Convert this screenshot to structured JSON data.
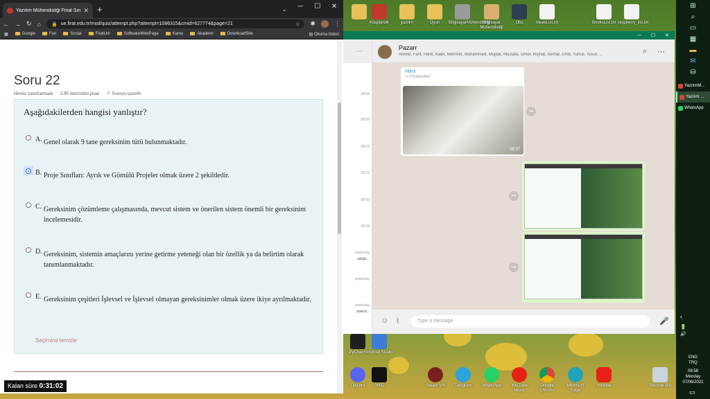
{
  "browser": {
    "tab_title": "Yazılım Mühendisliği Final Sınav...",
    "url": "ue.firat.edu.tr/mod/quiz/attempt.php?attempt=1086315&cmid=627774&page=21",
    "bookmarks": [
      "Google",
      "Fun",
      "Social",
      "FiratUni",
      "SoftwareWebPage",
      "Kamu",
      "Akademi",
      "DownloadSite"
    ],
    "reading_list": "Okuma listesi"
  },
  "quiz": {
    "title": "Soru 22",
    "status": "Henüz yanıtlanmadı",
    "points": "2.80 üzerinden puan",
    "flag": "Soruyu işaretle",
    "question": "Aşağıdakilerden hangisi yanlıştır?",
    "options": [
      {
        "letter": "A.",
        "text": "Genel olarak 9 tane gereksinim türü bulunmaktadır."
      },
      {
        "letter": "B.",
        "text": "Proje Sınıfları: Ayrık ve Gömülü Projeler olmak üzere 2 şekildedir."
      },
      {
        "letter": "C.",
        "text": "Gereksinim çözümleme çalışmasında, mevcut sistem ve önerilen sistem önemli bir gereksinim incelemesidir."
      },
      {
        "letter": "D.",
        "text": "Gereksinim, sistemin amaçlarını yerine getirme yeteneği olan bir özellik ya da belirtim olarak tanımlanmaktadır."
      },
      {
        "letter": "E.",
        "text": "Gereksinim çeşitleri İşlevsel ve İşlevsel olmayan gereksinimler olmak üzere ikiye ayrılmaktadır."
      }
    ],
    "selected": "B",
    "clear": "Seçimimi temizle",
    "timer_label": "Kalan süre",
    "timer_value": "0:31:02"
  },
  "whatsapp": {
    "chat_name": "Pazarr",
    "members": "Ahmet, Ferit, Hilmi, Kadir, Mehmet, Muhammed, Mujdat, Mustafa, Ömer, Rojhat, Serhat, Ümit, Yunus, Yusuf, ...",
    "sender": "Hilmi",
    "forwarded": "Forwarded",
    "msg_time": "08:57",
    "placeholder": "Type a message",
    "list_times": [
      "08:58",
      "08:58",
      "08:23",
      "08:23",
      "08:06",
      "00:28",
      "yesterday",
      "yesterday",
      "yesterday"
    ],
    "list_snippets": [
      "yduğu...",
      "askerli..."
    ]
  },
  "desktop_icons_top": [
    "",
    "Kitaplardik",
    "yazilim",
    "Oyun",
    "BilgisayarMühendisliği",
    "Bilgisayar Mühendisliği",
    "Obs",
    "IdeasList.txt",
    "BooksList.txt",
    "raspberry_list.txt"
  ],
  "desktop_icons_bottom": [
    "PyCharm",
    "Android Studio",
    "Discord",
    "GRID",
    "Steam VR",
    "Telegram",
    "WhatsApp",
    "YouTube Music",
    "Google Chrome",
    "Microsoft Edge",
    "Youtube",
    "Recycle Bin"
  ],
  "taskbar": {
    "items": [
      "YazılımM...",
      "Yazılım ...",
      "WhatsApp"
    ],
    "lang": "ENG",
    "kbd": "TRQ",
    "time": "08:58",
    "day": "Monday",
    "date": "07/06/2021"
  },
  "colors": {
    "whatsapp_green": "#0a7a55",
    "quiz_bg": "#e7f3f5",
    "selected_radio": "#2b6fc9"
  }
}
